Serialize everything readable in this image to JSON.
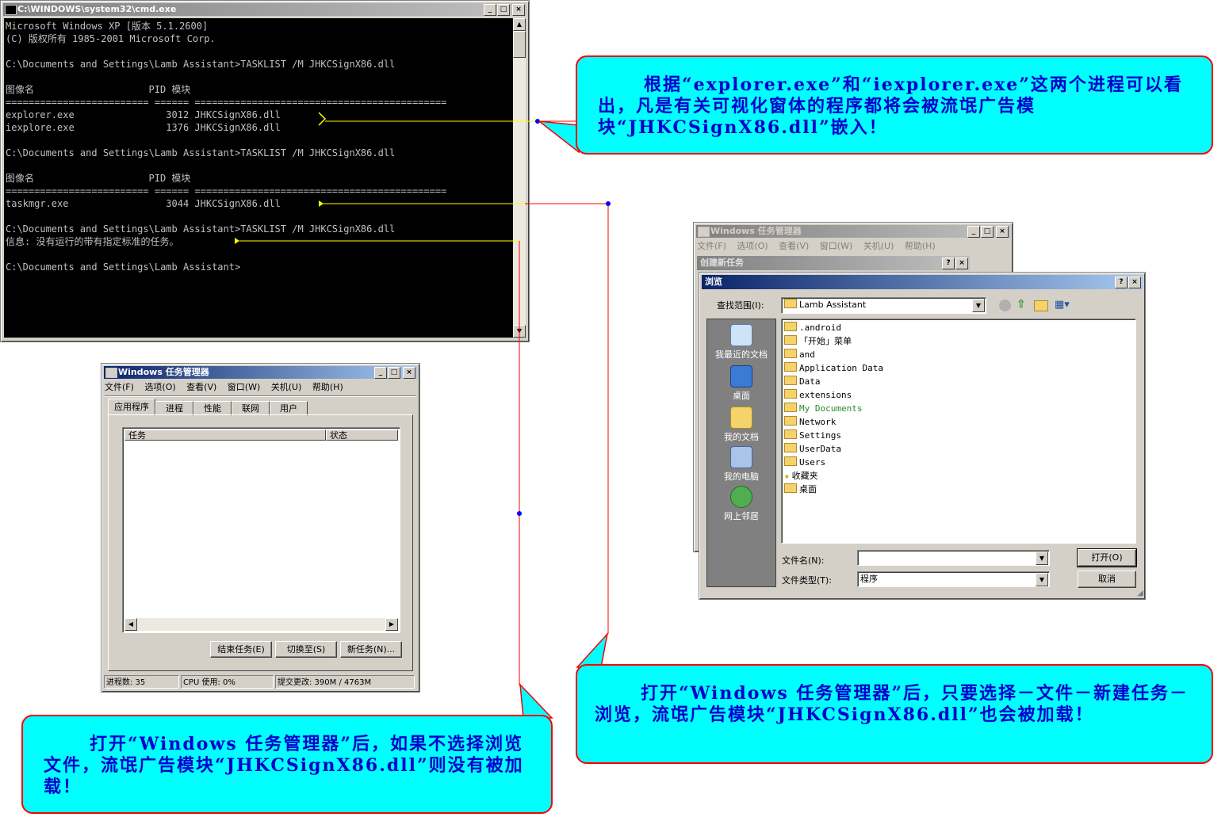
{
  "cmd": {
    "title": "C:\\WINDOWS\\system32\\cmd.exe",
    "lines": [
      "Microsoft Windows XP [版本 5.1.2600]",
      "(C) 版权所有 1985-2001 Microsoft Corp.",
      "",
      "C:\\Documents and Settings\\Lamb Assistant>TASKLIST /M JHKCSignX86.dll",
      "",
      "图像名                    PID 模块",
      "========================= ====== ============================================",
      "explorer.exe                3012 JHKCSignX86.dll",
      "iexplore.exe                1376 JHKCSignX86.dll",
      "",
      "C:\\Documents and Settings\\Lamb Assistant>TASKLIST /M JHKCSignX86.dll",
      "",
      "图像名                    PID 模块",
      "========================= ====== ============================================",
      "taskmgr.exe                 3044 JHKCSignX86.dll",
      "",
      "C:\\Documents and Settings\\Lamb Assistant>TASKLIST /M JHKCSignX86.dll",
      "信息: 没有运行的带有指定标准的任务。",
      "",
      "C:\\Documents and Settings\\Lamb Assistant>"
    ]
  },
  "taskmgr_small": {
    "title": "Windows 任务管理器",
    "menu": [
      "文件(F)",
      "选项(O)",
      "查看(V)",
      "窗口(W)",
      "关机(U)",
      "帮助(H)"
    ],
    "tabs": [
      "应用程序",
      "进程",
      "性能",
      "联网",
      "用户"
    ],
    "columns": [
      "任务",
      "状态"
    ],
    "buttons": [
      "结束任务(E)",
      "切换至(S)",
      "新任务(N)..."
    ],
    "status": [
      "进程数: 35",
      "CPU 使用: 0%",
      "提交更改: 390M / 4763M"
    ]
  },
  "taskmgr_back": {
    "title": "Windows 任务管理器",
    "menu": [
      "文件(F)",
      "选项(O)",
      "查看(V)",
      "窗口(W)",
      "关机(U)",
      "帮助(H)"
    ],
    "new_task_title": "创建新任务"
  },
  "browse": {
    "title": "浏览",
    "lookin_label": "查找范围(I):",
    "lookin_value": "Lamb Assistant",
    "places": [
      "我最近的文档",
      "桌面",
      "我的文档",
      "我的电脑",
      "网上邻居"
    ],
    "files": [
      ".android",
      "「开始」菜单",
      "and",
      "Application Data",
      "Data",
      "extensions",
      "My Documents",
      "Network",
      "Settings",
      "UserData",
      "Users",
      "收藏夹",
      "桌面"
    ],
    "filename_label": "文件名(N):",
    "filetype_label": "文件类型(T):",
    "filetype_value": "程序",
    "open_button": "打开(O)",
    "cancel_button": "取消"
  },
  "callouts": {
    "top_right": "根据“explorer.exe”和“iexplorer.exe”这两个进程可以看出，凡是有关可视化窗体的程序都将会被流氓广告模块“JHKCSignX86.dll”嵌入！",
    "bottom_right": "打开“Windows 任务管理器”后，只要选择－文件－新建任务－浏览，流氓广告模块“JHKCSignX86.dll”也会被加载！",
    "bottom_left": "打开“Windows 任务管理器”后，如果不选择浏览文件，流氓广告模块“JHKCSignX86.dll”则没有被加载！"
  },
  "colors": {
    "callout_bg": "#00ffff",
    "callout_border": "#ff0000",
    "callout_text": "#0000cc",
    "connector_yellow": "#ffff00",
    "connector_red": "#ff0000",
    "dot_blue": "#0000ff"
  }
}
